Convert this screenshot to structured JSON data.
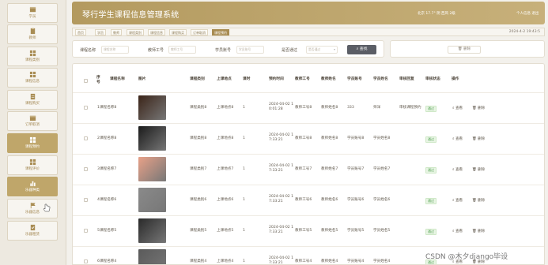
{
  "sidebar": {
    "items": [
      {
        "label": "学员",
        "icon": "user-icon",
        "active": false
      },
      {
        "label": "教师",
        "icon": "clipboard-icon",
        "active": false
      },
      {
        "label": "课程类别",
        "icon": "grid-icon",
        "active": false
      },
      {
        "label": "课程信息",
        "icon": "grid-icon",
        "active": false
      },
      {
        "label": "课程购买",
        "icon": "document-icon",
        "active": false
      },
      {
        "label": "订单取消",
        "icon": "calendar-icon",
        "active": false
      },
      {
        "label": "课程预约",
        "icon": "grid-icon",
        "active": true
      },
      {
        "label": "课程评价",
        "icon": "grid-icon",
        "active": false
      },
      {
        "label": "乐器种类",
        "icon": "bar-chart-icon",
        "active": false
      },
      {
        "label": "乐器信息",
        "icon": "flag-icon",
        "active": false
      },
      {
        "label": "乐器租赁",
        "icon": "clipboard-check-icon",
        "active": false
      }
    ]
  },
  "header": {
    "title": "琴行学生课程信息管理系统",
    "weather": "北京 17.7° 阴 西风 2级",
    "user": "个人信息 退出"
  },
  "breadcrumbs": [
    "首页",
    "学员",
    "教师",
    "课程类别",
    "课程信息",
    "课程购买",
    "订单取消",
    "课程预约"
  ],
  "date": "2024-4-2 19:43:5",
  "search": {
    "fields": [
      {
        "label": "课程名称",
        "placeholder": "课程名称"
      },
      {
        "label": "教师工号",
        "placeholder": "教师工号"
      },
      {
        "label": "学员账号",
        "placeholder": "学员账号"
      }
    ],
    "select_label": "是否通过",
    "select_placeholder": "是否通过",
    "button": "查找"
  },
  "delete_button": "删除",
  "table": {
    "headers": [
      "序号",
      "课程名称",
      "图片",
      "课程类别",
      "上课地点",
      "课时",
      "预约时间",
      "教师工号",
      "教师姓名",
      "学员账号",
      "学员姓名",
      "审核回复",
      "审核状态",
      "操作"
    ],
    "rows": [
      {
        "no": "1",
        "name": "课程名称8",
        "category": "课程类别8",
        "place": "上课地点8",
        "hours": "1",
        "time": "2024-04-02 10:01:28",
        "tid": "教师工号8",
        "tname": "教师姓名8",
        "sid": "333",
        "sname": "师洋",
        "reply": "审核课程预约",
        "status": "通过",
        "thumb": "#3b2418"
      },
      {
        "no": "2",
        "name": "课程名称8",
        "category": "课程类别8",
        "place": "上课地点8",
        "hours": "1",
        "time": "2024-04-02 17:33:21",
        "tid": "教师工号8",
        "tname": "教师姓名8",
        "sid": "学员账号8",
        "sname": "学员姓名8",
        "reply": "",
        "status": "通过",
        "thumb": "#1b1b1b"
      },
      {
        "no": "3",
        "name": "课程名称7",
        "category": "课程类别7",
        "place": "上课地点7",
        "hours": "1",
        "time": "2024-04-02 17:33:21",
        "tid": "教师工号7",
        "tname": "教师姓名7",
        "sid": "学员账号7",
        "sname": "学员姓名7",
        "reply": "",
        "status": "通过",
        "thumb": "#e8a188"
      },
      {
        "no": "4",
        "name": "课程名称6",
        "category": "课程类别6",
        "place": "上课地点6",
        "hours": "1",
        "time": "2024-04-02 17:33:21",
        "tid": "教师工号6",
        "tname": "教师姓名6",
        "sid": "学员账号6",
        "sname": "学员姓名6",
        "reply": "",
        "status": "通过",
        "thumb": "#8a8a8a"
      },
      {
        "no": "5",
        "name": "课程名称5",
        "category": "课程类别5",
        "place": "上课地点5",
        "hours": "1",
        "time": "2024-04-02 17:33:21",
        "tid": "教师工号5",
        "tname": "教师姓名5",
        "sid": "学员账号5",
        "sname": "学员姓名5",
        "reply": "",
        "status": "通过",
        "thumb": "#2a2a2a"
      },
      {
        "no": "6",
        "name": "课程名称4",
        "category": "课程类别4",
        "place": "上课地点4",
        "hours": "1",
        "time": "2024-04-02 17:33:21",
        "tid": "教师工号4",
        "tname": "教师姓名4",
        "sid": "学员账号4",
        "sname": "学员姓名4",
        "reply": "",
        "status": "通过",
        "thumb": "#5a5a5a"
      }
    ],
    "action_view": "查看",
    "action_delete": "删除"
  },
  "watermark": "CSDN @木夕django毕设",
  "colors": {
    "accent": "#bfa66a",
    "header": "#b39a5f",
    "search_button": "#5b5e66",
    "status_green": "#4f9e4f"
  }
}
